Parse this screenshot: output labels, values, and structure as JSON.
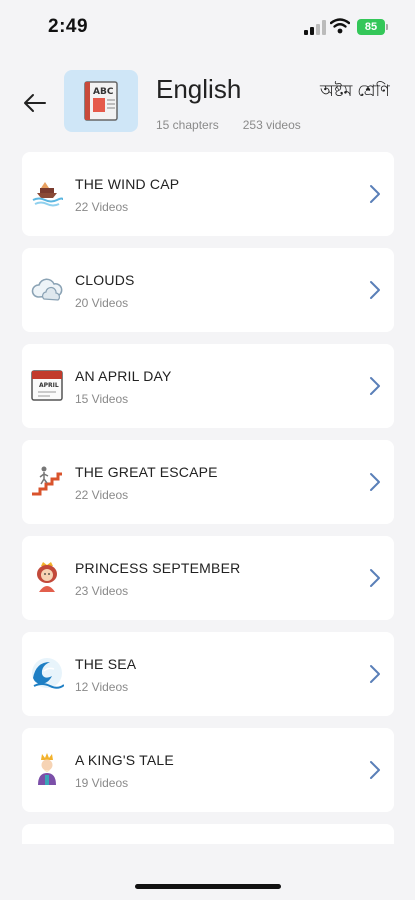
{
  "status": {
    "time": "2:49",
    "battery": "85"
  },
  "header": {
    "title": "English",
    "chapters": "15 chapters",
    "videos": "253 videos",
    "class_label": "অষ্টম শ্রেণি"
  },
  "chapters": [
    {
      "title": "THE WIND CAP",
      "videos": "22 Videos",
      "icon": "ship-icon"
    },
    {
      "title": "CLOUDS",
      "videos": "20 Videos",
      "icon": "cloud-icon"
    },
    {
      "title": "AN APRIL DAY",
      "videos": "15 Videos",
      "icon": "calendar-icon"
    },
    {
      "title": "THE GREAT ESCAPE",
      "videos": "22 Videos",
      "icon": "stairs-icon"
    },
    {
      "title": "PRINCESS SEPTEMBER",
      "videos": "23 Videos",
      "icon": "princess-icon"
    },
    {
      "title": "THE SEA",
      "videos": "12 Videos",
      "icon": "wave-icon"
    },
    {
      "title": "A KING'S TALE",
      "videos": "19 Videos",
      "icon": "king-icon"
    }
  ]
}
